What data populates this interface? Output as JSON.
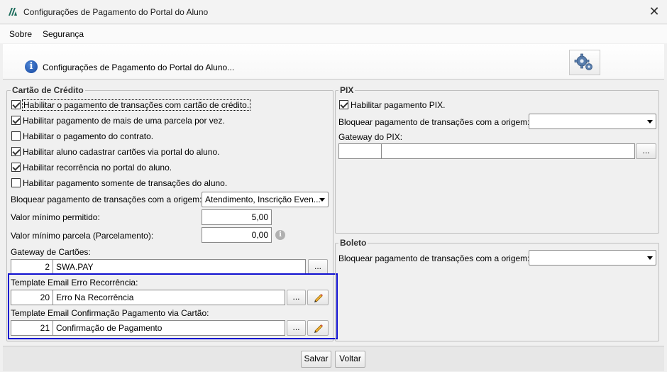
{
  "window": {
    "title": "Configurações de Pagamento do Portal do Aluno",
    "close_glyph": "✕"
  },
  "menu": {
    "items": [
      "Sobre",
      "Segurança"
    ]
  },
  "header": {
    "text": "Configurações de Pagamento do Portal do Aluno...",
    "icon": "info-icon",
    "right_icon": "gears-icon"
  },
  "credit_card": {
    "legend": "Cartão de Crédito",
    "checkboxes": [
      {
        "label": "Habilitar o pagamento de transações com cartão de crédito.",
        "checked": true
      },
      {
        "label": "Habilitar pagamento de mais de uma parcela por vez.",
        "checked": true
      },
      {
        "label": "Habilitar o pagamento do contrato.",
        "checked": false
      },
      {
        "label": "Habilitar aluno cadastrar cartões via portal do aluno.",
        "checked": true
      },
      {
        "label": "Habilitar recorrência no portal do aluno.",
        "checked": true
      },
      {
        "label": "Habilitar pagamento somente de transações do aluno.",
        "checked": false
      }
    ],
    "block_origin_label": "Bloquear pagamento de transações com a origem:",
    "block_origin_value": "Atendimento, Inscrição Even...",
    "min_value_label": "Valor mínimo permitido:",
    "min_value": "5,00",
    "min_installment_label": "Valor mínimo parcela (Parcelamento):",
    "min_installment": "0,00",
    "gateway_label": "Gateway de Cartões:",
    "gateway_code": "2",
    "gateway_name": "SWA.PAY",
    "template_error_label": "Template Email Erro Recorrência:",
    "template_error_code": "20",
    "template_error_name": "Erro Na Recorrência",
    "template_confirm_label": "Template Email Confirmação Pagamento via Cartão:",
    "template_confirm_code": "21",
    "template_confirm_name": "Confirmação de Pagamento",
    "lookup_label": "..."
  },
  "pix": {
    "legend": "PIX",
    "enable_label": "Habilitar pagamento PIX.",
    "enable_checked": true,
    "block_origin_label": "Bloquear pagamento de transações com a origem:",
    "block_origin_value": "",
    "gateway_label": "Gateway do PIX:",
    "gateway_code": "",
    "gateway_name": "",
    "lookup_label": "..."
  },
  "boleto": {
    "legend": "Boleto",
    "block_origin_label": "Bloquear pagamento de transações com a origem:",
    "block_origin_value": ""
  },
  "footer": {
    "save_label": "Salvar",
    "back_label": "Voltar"
  },
  "colors": {
    "highlight_border": "#1010d0",
    "info_blue": "#14459e"
  }
}
